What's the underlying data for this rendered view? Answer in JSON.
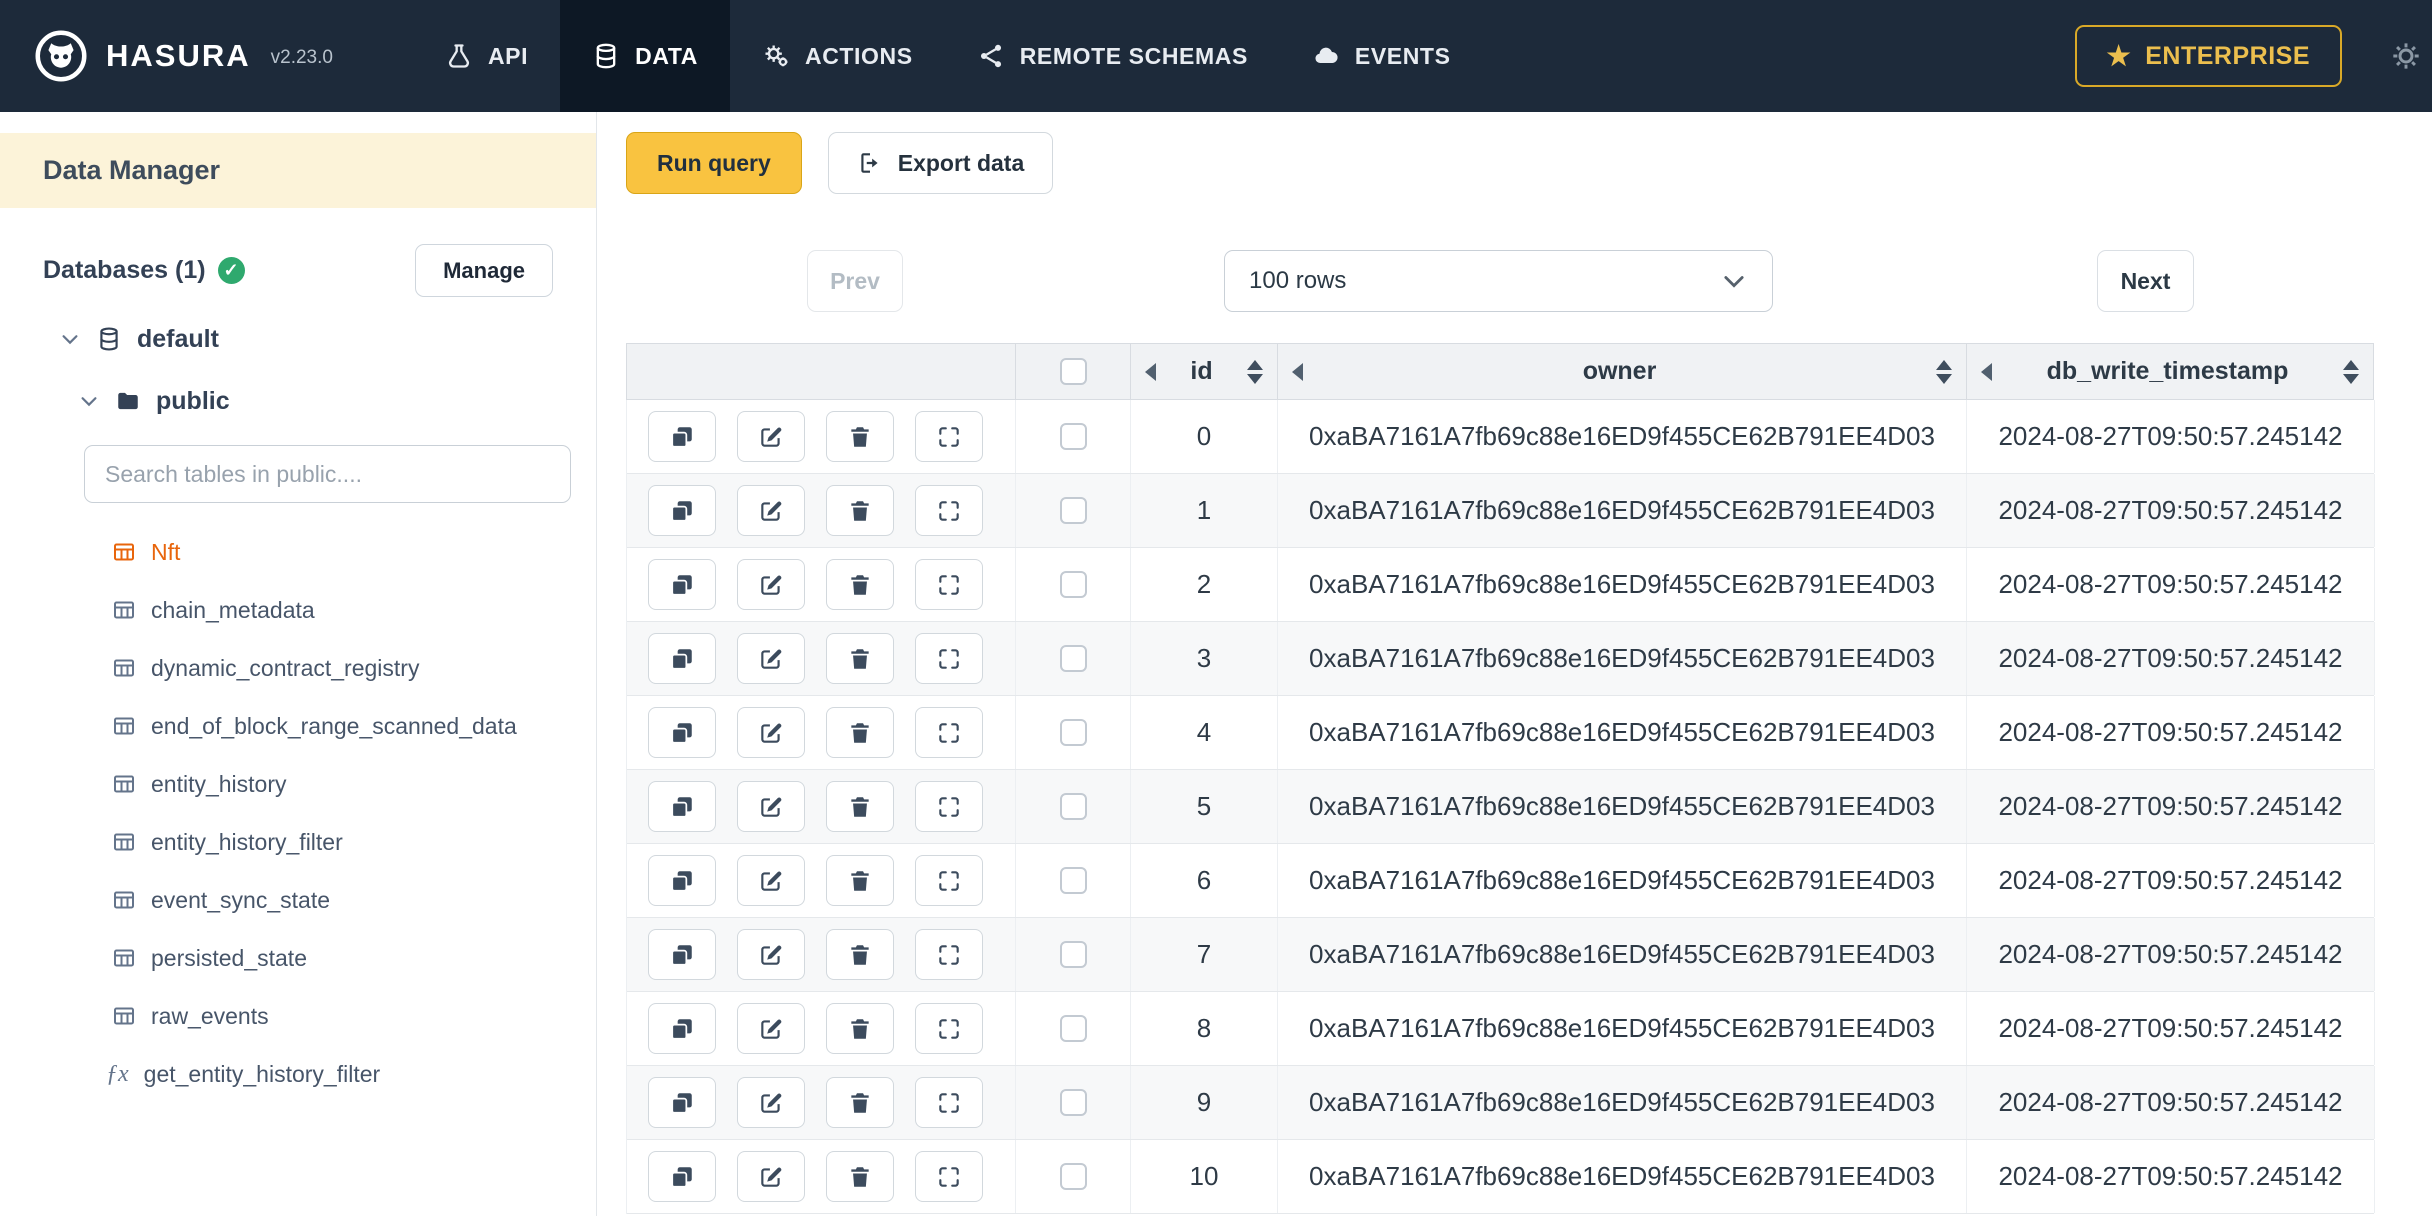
{
  "navbar": {
    "brand": "HASURA",
    "version": "v2.23.0",
    "items": [
      {
        "label": "API",
        "icon": "flask-icon",
        "active": false
      },
      {
        "label": "DATA",
        "icon": "database-icon",
        "active": true
      },
      {
        "label": "ACTIONS",
        "icon": "gears-icon",
        "active": false
      },
      {
        "label": "REMOTE SCHEMAS",
        "icon": "share-nodes-icon",
        "active": false
      },
      {
        "label": "EVENTS",
        "icon": "cloud-icon",
        "active": false
      }
    ],
    "enterprise_label": "ENTERPRISE",
    "right_icons": [
      "star-icon",
      "settings-gear-icon"
    ]
  },
  "sidebar": {
    "title": "Data Manager",
    "databases_label": "Databases (1)",
    "databases_status_icon": "check-circle-icon",
    "manage_button": "Manage",
    "tree": {
      "database": "default",
      "schema": "public"
    },
    "search_placeholder": "Search tables in public....",
    "highlighted_tables": [
      "Nft"
    ],
    "tables": [
      "chain_metadata",
      "dynamic_contract_registry",
      "end_of_block_range_scanned_data",
      "entity_history",
      "entity_history_filter",
      "event_sync_state",
      "persisted_state",
      "raw_events"
    ],
    "functions": [
      "get_entity_history_filter"
    ]
  },
  "toolbar": {
    "run_query": "Run query",
    "export_data": "Export data",
    "export_icon": "export-icon"
  },
  "pagination": {
    "prev": "Prev",
    "rows_select": "100 rows",
    "next": "Next"
  },
  "table": {
    "columns": [
      "id",
      "owner",
      "db_write_timestamp"
    ],
    "row_action_icons": [
      "copy-icon",
      "edit-icon",
      "delete-icon",
      "expand-icon"
    ],
    "rows": [
      {
        "id": "0",
        "owner": "0xaBA7161A7fb69c88e16ED9f455CE62B791EE4D03",
        "db_write_timestamp": "2024-08-27T09:50:57.245142"
      },
      {
        "id": "1",
        "owner": "0xaBA7161A7fb69c88e16ED9f455CE62B791EE4D03",
        "db_write_timestamp": "2024-08-27T09:50:57.245142"
      },
      {
        "id": "2",
        "owner": "0xaBA7161A7fb69c88e16ED9f455CE62B791EE4D03",
        "db_write_timestamp": "2024-08-27T09:50:57.245142"
      },
      {
        "id": "3",
        "owner": "0xaBA7161A7fb69c88e16ED9f455CE62B791EE4D03",
        "db_write_timestamp": "2024-08-27T09:50:57.245142"
      },
      {
        "id": "4",
        "owner": "0xaBA7161A7fb69c88e16ED9f455CE62B791EE4D03",
        "db_write_timestamp": "2024-08-27T09:50:57.245142"
      },
      {
        "id": "5",
        "owner": "0xaBA7161A7fb69c88e16ED9f455CE62B791EE4D03",
        "db_write_timestamp": "2024-08-27T09:50:57.245142"
      },
      {
        "id": "6",
        "owner": "0xaBA7161A7fb69c88e16ED9f455CE62B791EE4D03",
        "db_write_timestamp": "2024-08-27T09:50:57.245142"
      },
      {
        "id": "7",
        "owner": "0xaBA7161A7fb69c88e16ED9f455CE62B791EE4D03",
        "db_write_timestamp": "2024-08-27T09:50:57.245142"
      },
      {
        "id": "8",
        "owner": "0xaBA7161A7fb69c88e16ED9f455CE62B791EE4D03",
        "db_write_timestamp": "2024-08-27T09:50:57.245142"
      },
      {
        "id": "9",
        "owner": "0xaBA7161A7fb69c88e16ED9f455CE62B791EE4D03",
        "db_write_timestamp": "2024-08-27T09:50:57.245142"
      },
      {
        "id": "10",
        "owner": "0xaBA7161A7fb69c88e16ED9f455CE62B791EE4D03",
        "db_write_timestamp": "2024-08-27T09:50:57.245142"
      }
    ]
  },
  "colors": {
    "navbar_bg": "#1d2a3a",
    "navbar_active_bg": "#0d1825",
    "enterprise_gold": "#ecbf4e",
    "run_query_yellow": "#f9c340",
    "data_manager_band": "#fcf3d9",
    "highlighted_table_orange": "#e8650c",
    "check_green": "#2fa96e",
    "table_header_bg": "#f0f2f4"
  }
}
